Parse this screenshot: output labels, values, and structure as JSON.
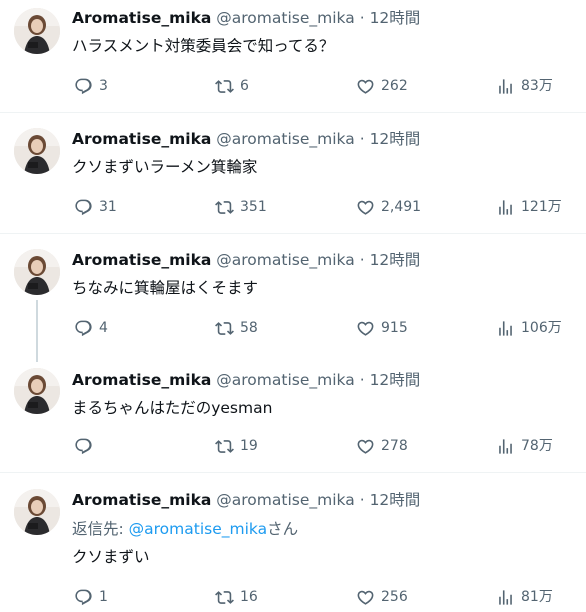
{
  "colors": {
    "text": "#0f1419",
    "muted": "#536471",
    "link": "#1d9bf0",
    "divider": "#eff3f4"
  },
  "tweets": [
    {
      "display_name": "Aromatise_mika",
      "handle": "@aromatise_mika",
      "sep": "·",
      "time": "12時間",
      "text": "ハラスメント対策委員会で知ってる？",
      "replies": "3",
      "retweets": "6",
      "likes": "262",
      "views": "83万"
    },
    {
      "display_name": "Aromatise_mika",
      "handle": "@aromatise_mika",
      "sep": "·",
      "time": "12時間",
      "text": "クソまずいラーメン箕輪家",
      "replies": "31",
      "retweets": "351",
      "likes": "2,491",
      "views": "121万"
    },
    {
      "display_name": "Aromatise_mika",
      "handle": "@aromatise_mika",
      "sep": "·",
      "time": "12時間",
      "text": "ちなみに箕輪屋はくそます",
      "replies": "4",
      "retweets": "58",
      "likes": "915",
      "views": "106万"
    },
    {
      "display_name": "Aromatise_mika",
      "handle": "@aromatise_mika",
      "sep": "·",
      "time": "12時間",
      "text": "まるちゃんはただのyesman",
      "replies": "",
      "retweets": "19",
      "likes": "278",
      "views": "78万"
    },
    {
      "display_name": "Aromatise_mika",
      "handle": "@aromatise_mika",
      "sep": "·",
      "time": "12時間",
      "replying_prefix": "返信先: ",
      "replying_mention": "@aromatise_mika",
      "replying_suffix": "さん",
      "text": "クソまずい",
      "replies": "1",
      "retweets": "16",
      "likes": "256",
      "views": "81万"
    }
  ],
  "icons": {
    "reply": "reply-icon",
    "retweet": "retweet-icon",
    "like": "heart-icon",
    "views": "views-icon"
  }
}
